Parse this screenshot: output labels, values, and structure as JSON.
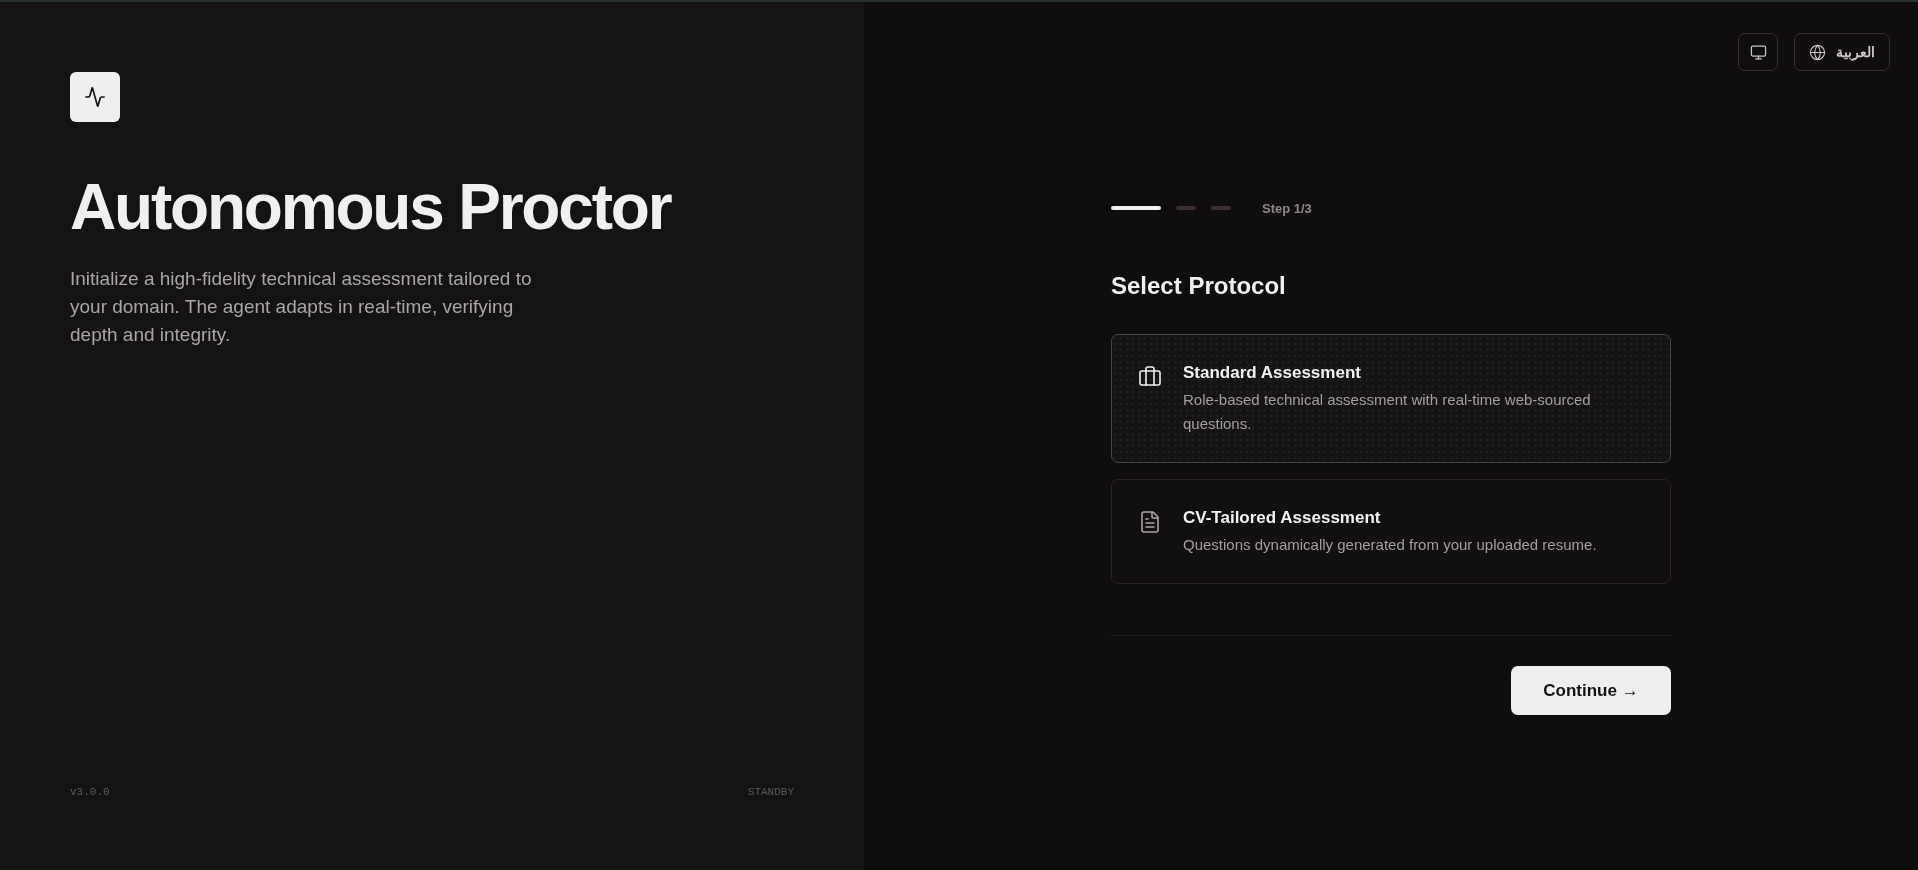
{
  "hero": {
    "title": "Autonomous Proctor",
    "description": "Initialize a high-fidelity technical assessment tailored to your domain. The agent adapts in real-time, verifying depth and integrity."
  },
  "footer": {
    "version": "v3.0.0",
    "status": "STANDBY"
  },
  "toolbar": {
    "language_button": "العربية"
  },
  "stepper": {
    "steps": [
      {
        "selected": true
      },
      {
        "selected": false
      },
      {
        "selected": false
      }
    ],
    "label": "Step 1/3"
  },
  "section_title": "Select Protocol",
  "options": [
    {
      "title": "Standard Assessment",
      "description": "Role-based technical assessment with real-time web-sourced questions.",
      "selected": true
    },
    {
      "title": "CV-Tailored Assessment",
      "description": "Questions dynamically generated from your uploaded resume.",
      "selected": false
    }
  ],
  "continue_button": "Continue →"
}
